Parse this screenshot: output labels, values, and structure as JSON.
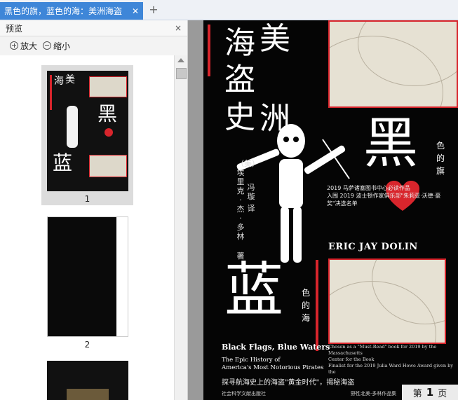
{
  "tab": {
    "title": "黑色的旗，蓝色的海：美洲海盗",
    "close": "✕",
    "new": "+"
  },
  "panel": {
    "title": "预览",
    "close": "×",
    "zoom_in": "放大",
    "zoom_out": "缩小",
    "thumbnails": [
      {
        "label": "1"
      },
      {
        "label": "2"
      }
    ]
  },
  "thumb1": {
    "hai": "海",
    "mei": "美",
    "hei": "黑",
    "lan": "蓝"
  },
  "cover": {
    "title_hai": "海",
    "title_mei": "美",
    "title_dao": "盗",
    "title_shi": "史",
    "title_zhou": "洲",
    "hei": "黑",
    "lan": "蓝",
    "sede_qi": "色的旗",
    "sede_hai": "色的海",
    "author_cn": "（美）埃里克·杰·多林",
    "zhu": "著",
    "translator": "冯璇",
    "yi": "译",
    "blurb": [
      "2019 马萨诸塞图书中心必读作品",
      "入围 2019 波士顿作家俱乐部\"朱莉亚·沃德·豪",
      "奖\"决选名单"
    ],
    "author_en": "ERIC JAY DOLIN",
    "title_en": "Black Flags, Blue Waters",
    "subtitle_en": [
      "The Epic History of",
      "America's Most Notorious Pirates"
    ],
    "award_en": [
      "Chosen as a \"Must-Read\" book for 2019 by the Massachusetts",
      "Center for the Book",
      "Finalist for the 2019 Julia Ward Howe Award given by the"
    ],
    "tagline_cn": "探寻航海史上的海盗\"黄金时代\"，揭秘海盗",
    "publisher": "社会科学文献出版社",
    "series": "野性北美·多林作品集"
  },
  "page_indicator": {
    "prefix": "第",
    "num": "1",
    "suffix": "页"
  },
  "colors": {
    "accent": "#3e86d8",
    "cover_red": "#d8252c",
    "cover_bg": "#050505"
  }
}
